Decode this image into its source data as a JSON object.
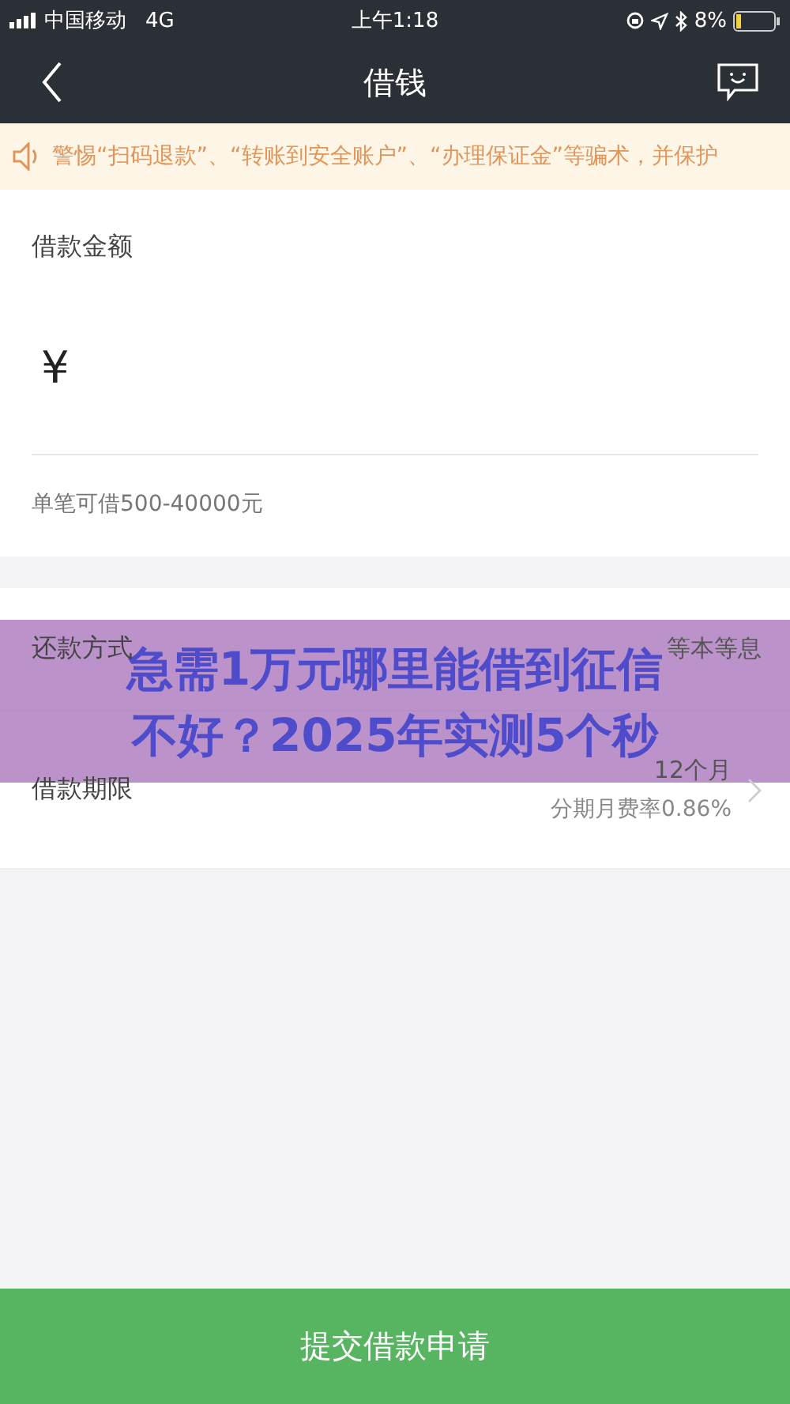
{
  "status_bar": {
    "carrier": "中国移动",
    "network": "4G",
    "time": "上午1:18",
    "battery": "8%"
  },
  "nav": {
    "title": "借钱"
  },
  "notice": {
    "text": "警惕“扫码退款”、“转账到安全账户”、“办理保证金”等骗术，并保护"
  },
  "amount": {
    "label": "借款金额",
    "currency": "¥",
    "hint": "单笔可借500-40000元"
  },
  "rows": [
    {
      "label": "还款方式",
      "value": "等本等息"
    },
    {
      "label": "借款期限",
      "value": "12个月",
      "sub": "分期月费率0.86%"
    }
  ],
  "overlay": {
    "lines": [
      "急需1万元哪里能借到征信",
      "不好？2025年实测5个秒"
    ]
  },
  "submit": {
    "label": "提交借款申请"
  }
}
